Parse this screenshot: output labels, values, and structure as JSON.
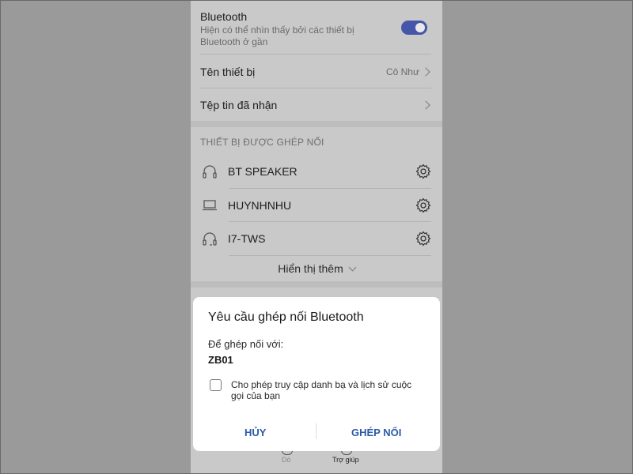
{
  "bluetooth": {
    "title": "Bluetooth",
    "subtitle": "Hiện có thể nhìn thấy bởi các thiết bị Bluetooth ở gần",
    "toggle_on": true
  },
  "device_name": {
    "label": "Tên thiết bị",
    "value": "Cô Như"
  },
  "received_files": {
    "label": "Tệp tin đã nhận"
  },
  "paired": {
    "header": "THIẾT BỊ ĐƯỢC GHÉP NỐI",
    "devices": [
      {
        "name": "BT SPEAKER",
        "icon": "headphones-icon"
      },
      {
        "name": "HUYNHNHU",
        "icon": "laptop-icon"
      },
      {
        "name": "I7-TWS",
        "icon": "headset-icon"
      }
    ],
    "show_more": "Hiển thị thêm"
  },
  "bottom_nav": {
    "item1": "Dò",
    "item2": "Trợ giúp"
  },
  "dialog": {
    "title": "Yêu cầu ghép nối Bluetooth",
    "pair_with_label": "Để ghép nối với:",
    "device": "ZB01",
    "checkbox_label": "Cho phép truy cập danh bạ và lịch sử cuộc gọi của bạn",
    "checkbox_checked": false,
    "cancel": "HỦY",
    "confirm": "GHÉP NỐI"
  },
  "colors": {
    "toggle_accent": "#4556a8",
    "dialog_button": "#2c5aa8"
  }
}
